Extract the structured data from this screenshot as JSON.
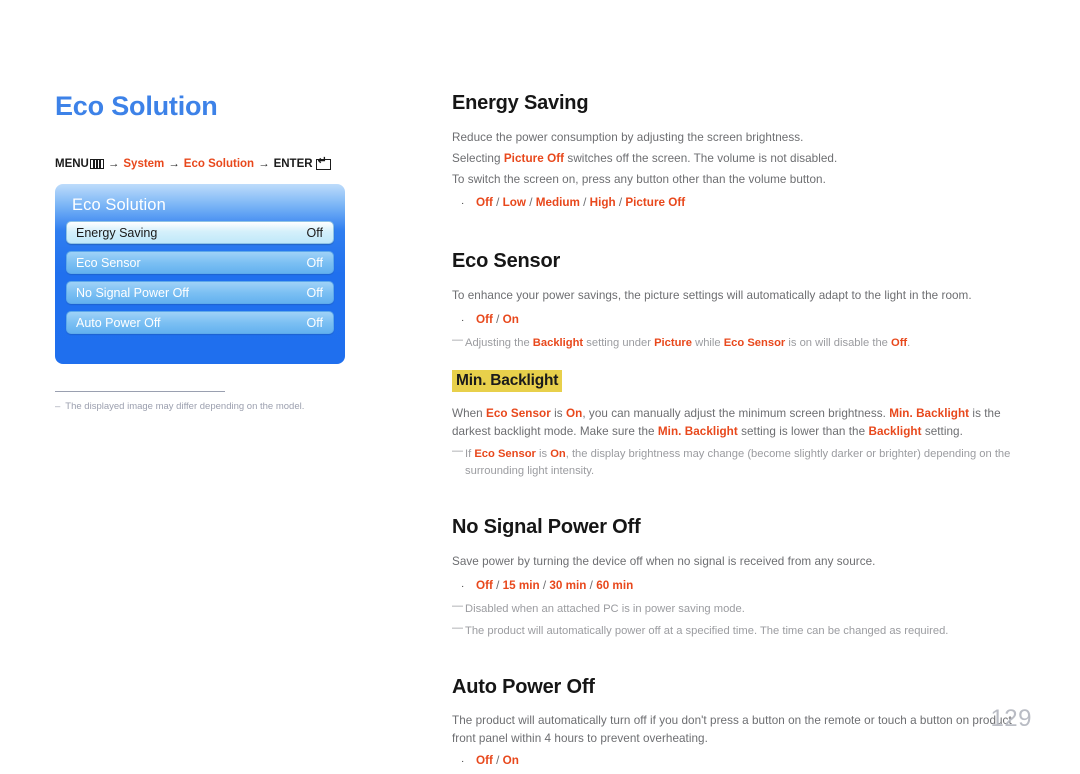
{
  "page": {
    "title": "Eco Solution",
    "number": "129"
  },
  "breadcrumb": {
    "menu_label": "MENU",
    "menu_icon": "menu-grid-icon",
    "arrow": "→",
    "item1": "System",
    "item2": "Eco Solution",
    "enter_label": "ENTER",
    "enter_icon": "enter-return-icon"
  },
  "osd": {
    "title": "Eco Solution",
    "rows": [
      {
        "label": "Energy Saving",
        "value": "Off",
        "selected": true
      },
      {
        "label": "Eco Sensor",
        "value": "Off",
        "selected": false
      },
      {
        "label": "No Signal Power Off",
        "value": "Off",
        "selected": false
      },
      {
        "label": "Auto Power Off",
        "value": "Off",
        "selected": false
      }
    ]
  },
  "left_note": {
    "dash": "–",
    "text": "The displayed image may differ depending on the model."
  },
  "sections": {
    "energy_saving": {
      "heading": "Energy Saving",
      "line1": "Reduce the power consumption by adjusting the screen brightness.",
      "line2_a": "Selecting ",
      "line2_red": "Picture Off",
      "line2_b": " switches off the screen. The volume is not disabled.",
      "line3": "To switch the screen on, press any button other than the volume button.",
      "bullet": {
        "marker": "·",
        "o1": "Off",
        "o2": "Low",
        "o3": "Medium",
        "o4": "High",
        "o5": "Picture Off",
        "sep": " / "
      }
    },
    "eco_sensor": {
      "heading": "Eco Sensor",
      "line1": "To enhance your power savings, the picture settings will automatically adapt to the light in the room.",
      "bullet": {
        "marker": "·",
        "o1": "Off",
        "o2": "On",
        "sep": " / "
      },
      "note": {
        "dash": "—",
        "t1": "Adjusting the ",
        "r1": "Backlight",
        "t2": " setting under ",
        "r2": "Picture",
        "t3": " while ",
        "r3": "Eco Sensor",
        "t4": " is on will disable the ",
        "r4": "Off",
        "t5": "."
      }
    },
    "min_backlight": {
      "heading": "Min. Backlight",
      "p1_a": "When ",
      "p1_r1": "Eco Sensor",
      "p1_b": " is ",
      "p1_r2": "On",
      "p1_c": ", you can manually adjust the minimum screen brightness. ",
      "p1_r3": "Min. Backlight",
      "p1_d": " is the darkest backlight mode. Make sure the ",
      "p1_r4": "Min. Backlight",
      "p1_e": " setting is lower than the ",
      "p1_r5": "Backlight",
      "p1_f": " setting.",
      "note": {
        "dash": "—",
        "t1": "If ",
        "r1": "Eco Sensor",
        "t2": " is ",
        "r2": "On",
        "t3": ", the display brightness may change (become slightly darker or brighter) depending on the surrounding light intensity."
      }
    },
    "no_signal_power_off": {
      "heading": "No Signal Power Off",
      "line1": "Save power by turning the device off when no signal is received from any source.",
      "bullet": {
        "marker": "·",
        "o1": "Off",
        "o2": "15 min",
        "o3": "30 min",
        "o4": "60 min",
        "sep": " / "
      },
      "note1": {
        "dash": "—",
        "text": "Disabled when an attached PC is in power saving mode."
      },
      "note2": {
        "dash": "—",
        "text": "The product will automatically power off at a specified time. The time can be changed as required."
      }
    },
    "auto_power_off": {
      "heading": "Auto Power Off",
      "p1": "The product will automatically turn off if you don't press a button on the remote or touch a button on product front panel within 4 hours to prevent overheating.",
      "bullet": {
        "marker": "·",
        "o1": "Off",
        "o2": "On",
        "sep": " / "
      }
    }
  }
}
